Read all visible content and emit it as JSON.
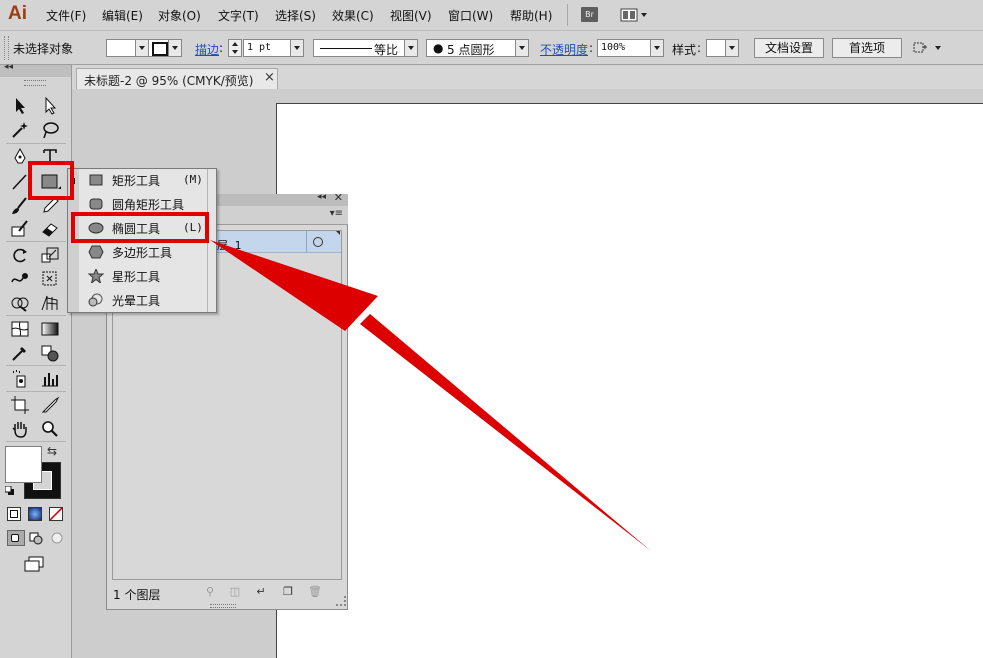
{
  "app": {
    "logo": "Ai"
  },
  "menubar": {
    "items": [
      "文件(F)",
      "编辑(E)",
      "对象(O)",
      "文字(T)",
      "选择(S)",
      "效果(C)",
      "视图(V)",
      "窗口(W)",
      "帮助(H)"
    ],
    "bridge_label": "Br"
  },
  "control_bar": {
    "selection_status": "未选择对象",
    "stroke_label": "描边",
    "stroke_weight": "1 pt",
    "stroke_profile": "等比",
    "brush": "5 点圆形",
    "opacity_label": "不透明度",
    "opacity_value": "100%",
    "style_label": "样式",
    "doc_setup_button": "文档设置",
    "preferences_button": "首选项"
  },
  "document": {
    "tab_title": "未标题-2 @ 95% (CMYK/预览)",
    "tab_close": "×"
  },
  "tool_flyout": {
    "items": [
      {
        "label": "矩形工具",
        "shortcut": "(M)",
        "icon": "rectangle-icon"
      },
      {
        "label": "圆角矩形工具",
        "shortcut": "",
        "icon": "rounded-rectangle-icon"
      },
      {
        "label": "椭圆工具",
        "shortcut": "(L)",
        "icon": "ellipse-icon",
        "highlighted": true
      },
      {
        "label": "多边形工具",
        "shortcut": "",
        "icon": "polygon-icon"
      },
      {
        "label": "星形工具",
        "shortcut": "",
        "icon": "star-icon"
      },
      {
        "label": "光晕工具",
        "shortcut": "",
        "icon": "flare-icon"
      }
    ]
  },
  "layers_panel": {
    "layer_name": "层 1",
    "footer_label": "1 个图层"
  },
  "colors": {
    "highlight": "#e00000",
    "arrow": "#dd0000",
    "selected_layer_row": "#c3d6ec"
  }
}
